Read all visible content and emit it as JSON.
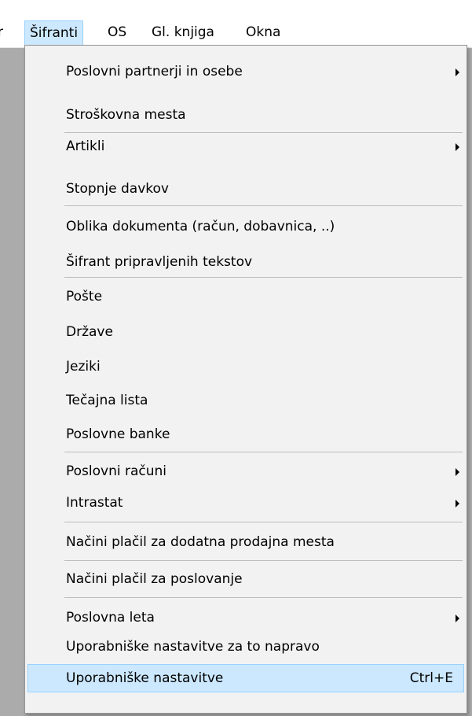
{
  "menubar": {
    "cut_item": "r",
    "sifranti": "Šifranti",
    "os": "OS",
    "gl_knjiga": "Gl. knjiga",
    "okna": "Okna"
  },
  "menu": {
    "items": [
      {
        "label": "Poslovni partnerji in osebe",
        "submenu": true
      },
      {
        "label": "Stroškovna mesta"
      },
      {
        "label": "Artikli",
        "submenu": true
      },
      {
        "label": "Stopnje davkov"
      },
      {
        "label": "Oblika dokumenta (račun, dobavnica, ..)"
      },
      {
        "label": "Šifrant pripravljenih tekstov"
      },
      {
        "label": "Pošte"
      },
      {
        "label": "Države"
      },
      {
        "label": "Jeziki"
      },
      {
        "label": "Tečajna lista"
      },
      {
        "label": "Poslovne banke"
      },
      {
        "label": "Poslovni računi",
        "submenu": true
      },
      {
        "label": "Intrastat",
        "submenu": true
      },
      {
        "label": "Načini plačil za dodatna prodajna mesta"
      },
      {
        "label": "Načini plačil za poslovanje"
      },
      {
        "label": "Poslovna leta",
        "submenu": true
      },
      {
        "label": "Uporabniške nastavitve za to napravo"
      },
      {
        "label": "Uporabniške nastavitve",
        "shortcut": "Ctrl+E",
        "highlighted": true
      }
    ]
  },
  "colors": {
    "highlight_bg": "#cce8ff",
    "highlight_border": "#99d1ff",
    "menu_bg": "#f2f2f2",
    "workspace_bg": "#ababab"
  }
}
